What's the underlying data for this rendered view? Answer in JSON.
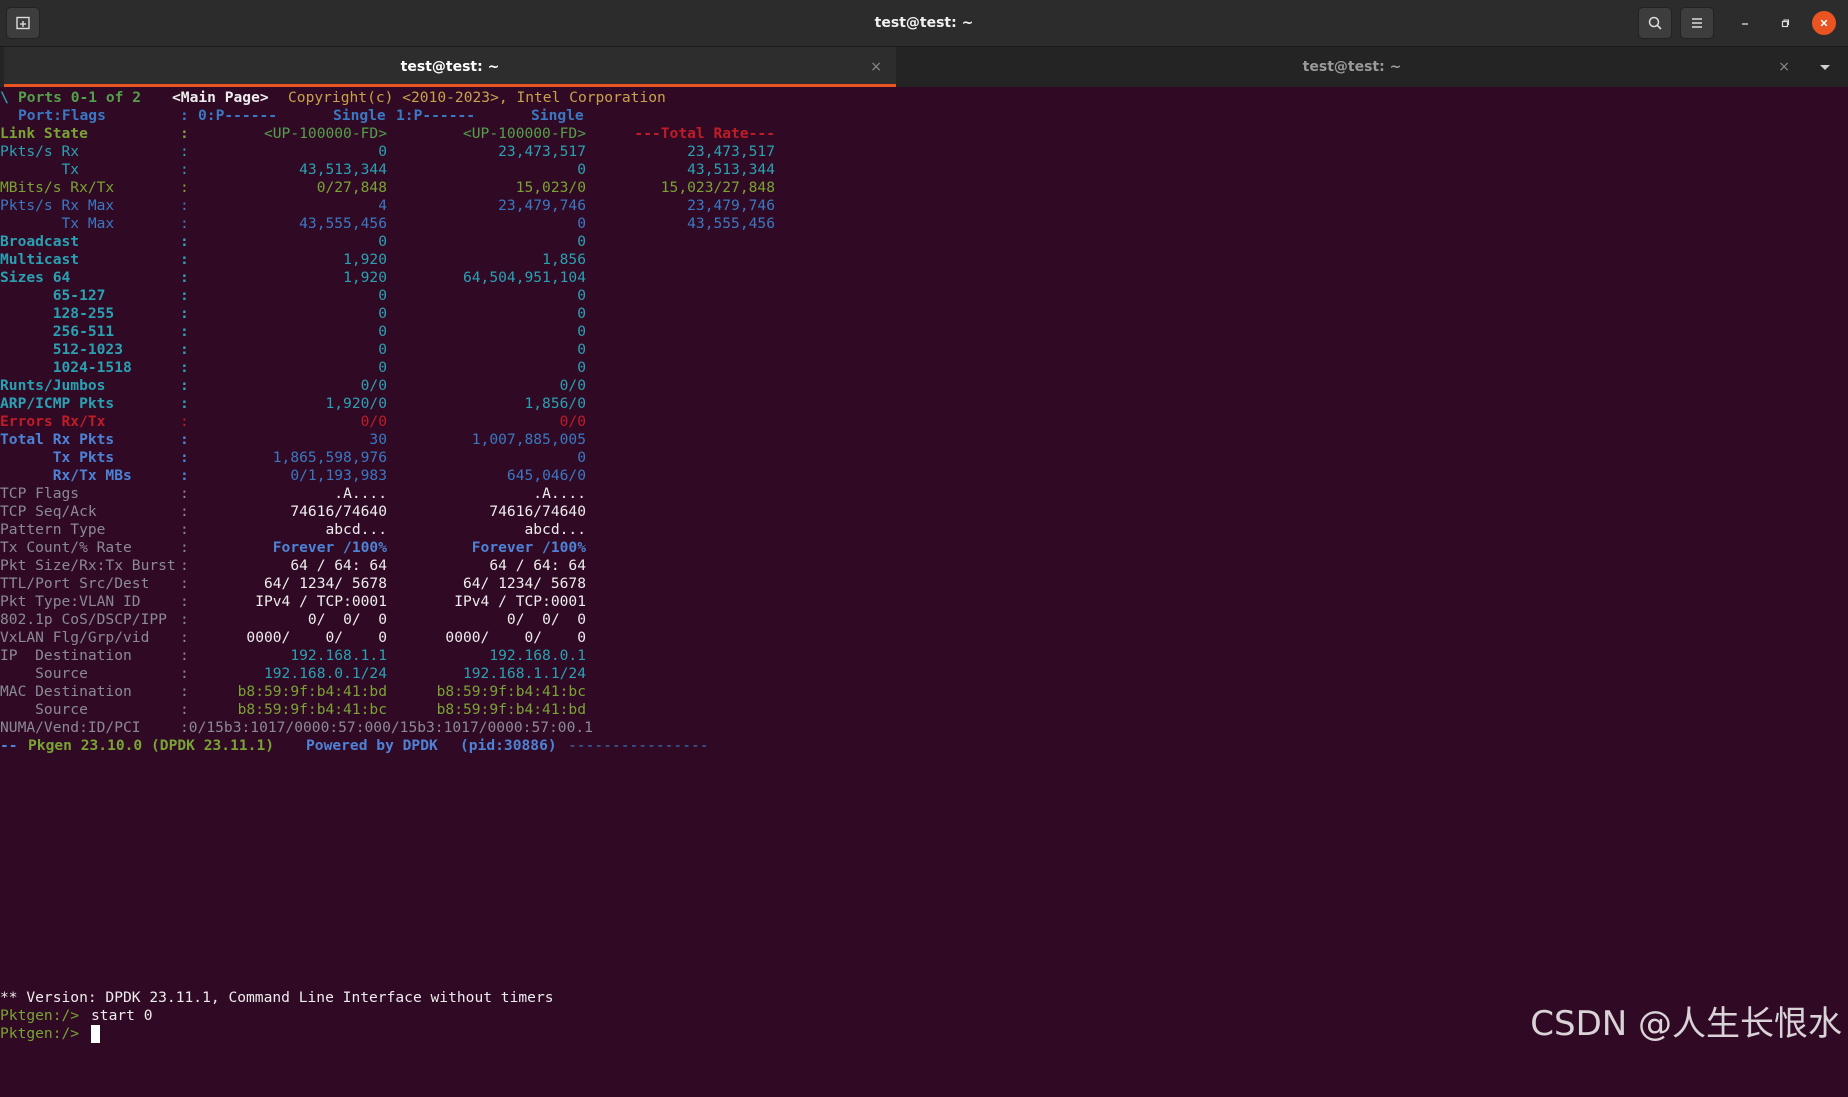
{
  "window": {
    "title": "test@test: ~"
  },
  "tabs": [
    {
      "label": "test@test: ~",
      "close": "×"
    },
    {
      "label": "test@test: ~",
      "close": "×"
    }
  ],
  "terminal": {
    "header": {
      "spinner": "\\",
      "ports": "Ports 0-1 of 2",
      "page": "<Main Page>",
      "copyright": "Copyright(c) <2010-2023>, Intel Corporation"
    },
    "port_flags": {
      "label": "Port:Flags",
      "sep": ":",
      "p0": "0:P------",
      "p0_mode": "Single",
      "p1": "1:P------",
      "p1_mode": "Single"
    },
    "rows": [
      {
        "label": "Link State",
        "sep": ":",
        "p0": "<UP-100000-FD>",
        "p1": "<UP-100000-FD>",
        "total": "---Total Rate---"
      },
      {
        "label": "Pkts/s Rx",
        "sep": ":",
        "p0": "0",
        "p1": "23,473,517",
        "total": "23,473,517"
      },
      {
        "label": "       Tx",
        "sep": ":",
        "p0": "43,513,344",
        "p1": "0",
        "total": "43,513,344"
      },
      {
        "label": "MBits/s Rx/Tx",
        "sep": ":",
        "p0": "0/27,848",
        "p1": "15,023/0",
        "total": "15,023/27,848"
      },
      {
        "label": "Pkts/s Rx Max",
        "sep": ":",
        "p0": "4",
        "p1": "23,479,746",
        "total": "23,479,746"
      },
      {
        "label": "       Tx Max",
        "sep": ":",
        "p0": "43,555,456",
        "p1": "0",
        "total": "43,555,456"
      },
      {
        "label": "Broadcast",
        "sep": ":",
        "p0": "0",
        "p1": "0",
        "total": ""
      },
      {
        "label": "Multicast",
        "sep": ":",
        "p0": "1,920",
        "p1": "1,856",
        "total": ""
      },
      {
        "label": "Sizes 64",
        "sep": ":",
        "p0": "1,920",
        "p1": "64,504,951,104",
        "total": ""
      },
      {
        "label": "      65-127",
        "sep": ":",
        "p0": "0",
        "p1": "0",
        "total": ""
      },
      {
        "label": "      128-255",
        "sep": ":",
        "p0": "0",
        "p1": "0",
        "total": ""
      },
      {
        "label": "      256-511",
        "sep": ":",
        "p0": "0",
        "p1": "0",
        "total": ""
      },
      {
        "label": "      512-1023",
        "sep": ":",
        "p0": "0",
        "p1": "0",
        "total": ""
      },
      {
        "label": "      1024-1518",
        "sep": ":",
        "p0": "0",
        "p1": "0",
        "total": ""
      },
      {
        "label": "Runts/Jumbos",
        "sep": ":",
        "p0": "0/0",
        "p1": "0/0",
        "total": ""
      },
      {
        "label": "ARP/ICMP Pkts",
        "sep": ":",
        "p0": "1,920/0",
        "p1": "1,856/0",
        "total": ""
      },
      {
        "label": "Errors Rx/Tx",
        "sep": ":",
        "p0": "0/0",
        "p1": "0/0",
        "total": ""
      },
      {
        "label": "Total Rx Pkts",
        "sep": ":",
        "p0": "30",
        "p1": "1,007,885,005",
        "total": ""
      },
      {
        "label": "      Tx Pkts",
        "sep": ":",
        "p0": "1,865,598,976",
        "p1": "0",
        "total": ""
      },
      {
        "label": "      Rx/Tx MBs",
        "sep": ":",
        "p0": "0/1,193,983",
        "p1": "645,046/0",
        "total": ""
      },
      {
        "label": "TCP Flags",
        "sep": ":",
        "p0": ".A....",
        "p1": ".A....",
        "total": ""
      },
      {
        "label": "TCP Seq/Ack",
        "sep": ":",
        "p0": "74616/74640",
        "p1": "74616/74640",
        "total": ""
      },
      {
        "label": "Pattern Type",
        "sep": ":",
        "p0": "abcd...",
        "p1": "abcd...",
        "total": ""
      },
      {
        "label": "Tx Count/% Rate",
        "sep": ":",
        "p0": "Forever /100%",
        "p1": "Forever /100%",
        "total": ""
      },
      {
        "label": "Pkt Size/Rx:Tx Burst",
        "sep": ":",
        "p0": "64 / 64: 64",
        "p1": "64 / 64: 64",
        "total": ""
      },
      {
        "label": "TTL/Port Src/Dest",
        "sep": ":",
        "p0": "64/ 1234/ 5678",
        "p1": "64/ 1234/ 5678",
        "total": ""
      },
      {
        "label": "Pkt Type:VLAN ID",
        "sep": ":",
        "p0": "IPv4 / TCP:0001",
        "p1": "IPv4 / TCP:0001",
        "total": ""
      },
      {
        "label": "802.1p CoS/DSCP/IPP",
        "sep": ":",
        "p0": "0/  0/  0",
        "p1": "0/  0/  0",
        "total": ""
      },
      {
        "label": "VxLAN Flg/Grp/vid",
        "sep": ":",
        "p0": "0000/    0/    0",
        "p1": "0000/    0/    0",
        "total": ""
      },
      {
        "label": "IP  Destination",
        "sep": ":",
        "p0": "192.168.1.1",
        "p1": "192.168.0.1",
        "total": ""
      },
      {
        "label": "    Source",
        "sep": ":",
        "p0": "192.168.0.1/24",
        "p1": "192.168.1.1/24",
        "total": ""
      },
      {
        "label": "MAC Destination",
        "sep": ":",
        "p0": "b8:59:9f:b4:41:bd",
        "p1": "b8:59:9f:b4:41:bc",
        "total": ""
      },
      {
        "label": "    Source",
        "sep": ":",
        "p0": "b8:59:9f:b4:41:bc",
        "p1": "b8:59:9f:b4:41:bd",
        "total": ""
      }
    ],
    "numa": {
      "label": "NUMA/Vend:ID/PCI",
      "value": ":0/15b3:1017/0000:57:000/15b3:1017/0000:57:00.1"
    },
    "footer": {
      "dash": "--",
      "app": "Pkgen 23.10.0 (DPDK 23.11.1)",
      "powered": "Powered by DPDK",
      "pid": "(pid:30886)",
      "rule": "----------------"
    },
    "version": "** Version: DPDK 23.11.1, Command Line Interface without timers",
    "prompt": "Pktgen:/>",
    "cmd1": "start 0",
    "cmd2": ""
  },
  "watermark": "CSDN @人生长恨水"
}
